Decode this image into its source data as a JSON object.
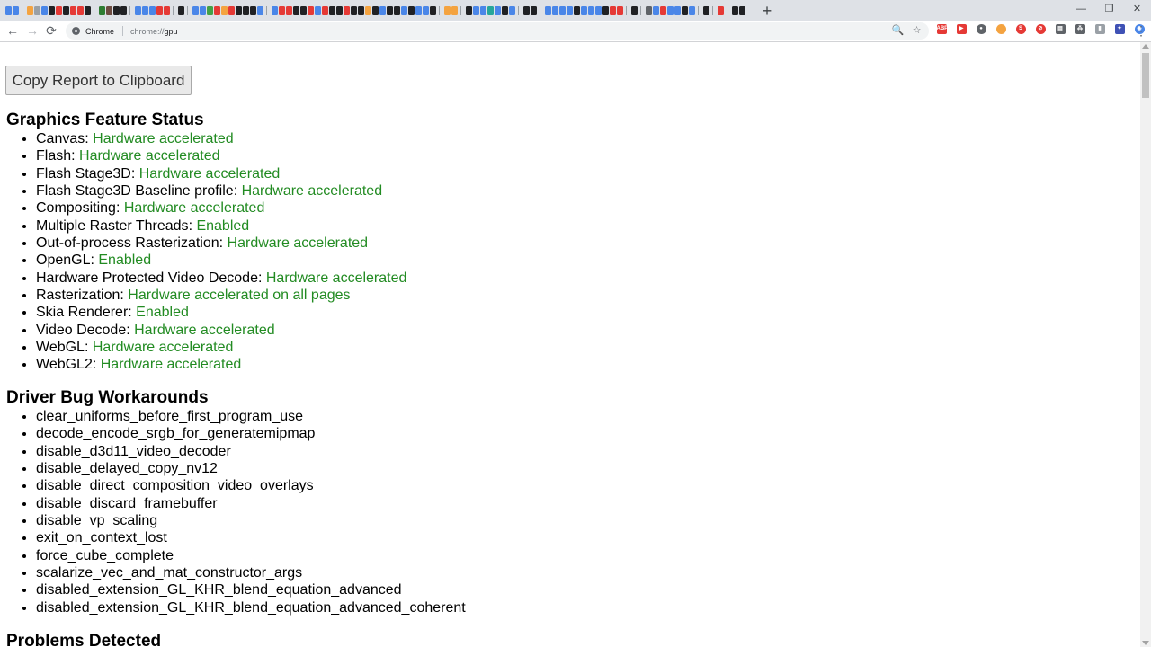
{
  "browser": {
    "window_controls": {
      "minimize": "—",
      "restore": "❐",
      "close": "✕"
    },
    "new_tab_label": "+",
    "pinned_tabs": {
      "groups": [
        [
          "#4a86e8",
          "#4a86e8"
        ],
        [
          "#f4a340",
          "#9aa0a6",
          "#4a86e8",
          "#202124",
          "#e53935",
          "#202124",
          "#e53935",
          "#e53935",
          "#202124"
        ],
        [
          "#2e7d32",
          "#6d4c41",
          "#202124",
          "#202124"
        ],
        [
          "#4a86e8",
          "#4a86e8",
          "#4a86e8",
          "#e53935",
          "#e53935"
        ],
        [
          "#202124"
        ],
        [
          "#4a86e8",
          "#4a86e8",
          "#43a047",
          "#e53935",
          "#f4a340",
          "#e53935",
          "#202124",
          "#202124",
          "#202124",
          "#4a86e8"
        ],
        [
          "#4a86e8",
          "#e53935",
          "#e53935",
          "#202124",
          "#202124",
          "#e53935",
          "#4a86e8",
          "#e53935",
          "#202124",
          "#202124",
          "#e53935",
          "#202124",
          "#202124",
          "#f4a340",
          "#202124",
          "#4a86e8",
          "#202124",
          "#202124",
          "#4a86e8",
          "#202124",
          "#4a86e8",
          "#4a86e8",
          "#202124"
        ],
        [
          "#f4a340",
          "#f4a340"
        ],
        [
          "#202124",
          "#4a86e8",
          "#4a86e8",
          "#26a69a",
          "#4a86e8",
          "#202124",
          "#4a86e8"
        ],
        [
          "#202124",
          "#202124"
        ],
        [
          "#4a86e8",
          "#4a86e8",
          "#4a86e8",
          "#4a86e8",
          "#202124",
          "#4a86e8",
          "#4a86e8",
          "#4a86e8",
          "#202124",
          "#e53935",
          "#e53935"
        ],
        [
          "#202124"
        ],
        [
          "#5f6368",
          "#4a86e8",
          "#e53935",
          "#4a86e8",
          "#4a86e8",
          "#202124",
          "#4a86e8"
        ],
        [
          "#202124"
        ],
        [
          "#e53935"
        ],
        [
          "#202124",
          "#202124"
        ]
      ]
    },
    "toolbar": {
      "back_icon": "←",
      "forward_icon": "→",
      "reload_icon": "⟳",
      "site_chip_label": "Chrome",
      "url_scheme": "chrome://",
      "url_path": "gpu",
      "zoom_icon": "🔍",
      "bookmark_icon": "☆",
      "menu_icon": "⋮",
      "extensions": [
        {
          "label": "ABP",
          "color": "#e53935",
          "round": false
        },
        {
          "label": "▶",
          "color": "#e53935",
          "round": false
        },
        {
          "label": "●",
          "color": "#5f6368",
          "round": true
        },
        {
          "label": "",
          "color": "#f4a340",
          "round": true
        },
        {
          "label": "S",
          "color": "#e53935",
          "round": true
        },
        {
          "label": "⊘",
          "color": "#e53935",
          "round": true
        },
        {
          "label": "▤",
          "color": "#5f6368",
          "round": false
        },
        {
          "label": "⁂",
          "color": "#5f6368",
          "round": false
        },
        {
          "label": "▮",
          "color": "#9aa0a6",
          "round": false
        },
        {
          "label": "✦",
          "color": "#3f51b5",
          "round": false
        },
        {
          "label": "◉",
          "color": "#4a86e8",
          "round": true
        }
      ]
    }
  },
  "page": {
    "copy_button_label": "Copy Report to Clipboard",
    "feature_status_heading": "Graphics Feature Status",
    "feature_status": [
      {
        "name": "Canvas",
        "status": "Hardware accelerated"
      },
      {
        "name": "Flash",
        "status": "Hardware accelerated"
      },
      {
        "name": "Flash Stage3D",
        "status": "Hardware accelerated"
      },
      {
        "name": "Flash Stage3D Baseline profile",
        "status": "Hardware accelerated"
      },
      {
        "name": "Compositing",
        "status": "Hardware accelerated"
      },
      {
        "name": "Multiple Raster Threads",
        "status": "Enabled"
      },
      {
        "name": "Out-of-process Rasterization",
        "status": "Hardware accelerated"
      },
      {
        "name": "OpenGL",
        "status": "Enabled"
      },
      {
        "name": "Hardware Protected Video Decode",
        "status": "Hardware accelerated"
      },
      {
        "name": "Rasterization",
        "status": "Hardware accelerated on all pages"
      },
      {
        "name": "Skia Renderer",
        "status": "Enabled"
      },
      {
        "name": "Video Decode",
        "status": "Hardware accelerated"
      },
      {
        "name": "WebGL",
        "status": "Hardware accelerated"
      },
      {
        "name": "WebGL2",
        "status": "Hardware accelerated"
      }
    ],
    "status_color": "#228b22",
    "workarounds_heading": "Driver Bug Workarounds",
    "workarounds": [
      "clear_uniforms_before_first_program_use",
      "decode_encode_srgb_for_generatemipmap",
      "disable_d3d11_video_decoder",
      "disable_delayed_copy_nv12",
      "disable_direct_composition_video_overlays",
      "disable_discard_framebuffer",
      "disable_vp_scaling",
      "exit_on_context_lost",
      "force_cube_complete",
      "scalarize_vec_and_mat_constructor_args",
      "disabled_extension_GL_KHR_blend_equation_advanced",
      "disabled_extension_GL_KHR_blend_equation_advanced_coherent"
    ],
    "problems_heading": "Problems Detected"
  }
}
